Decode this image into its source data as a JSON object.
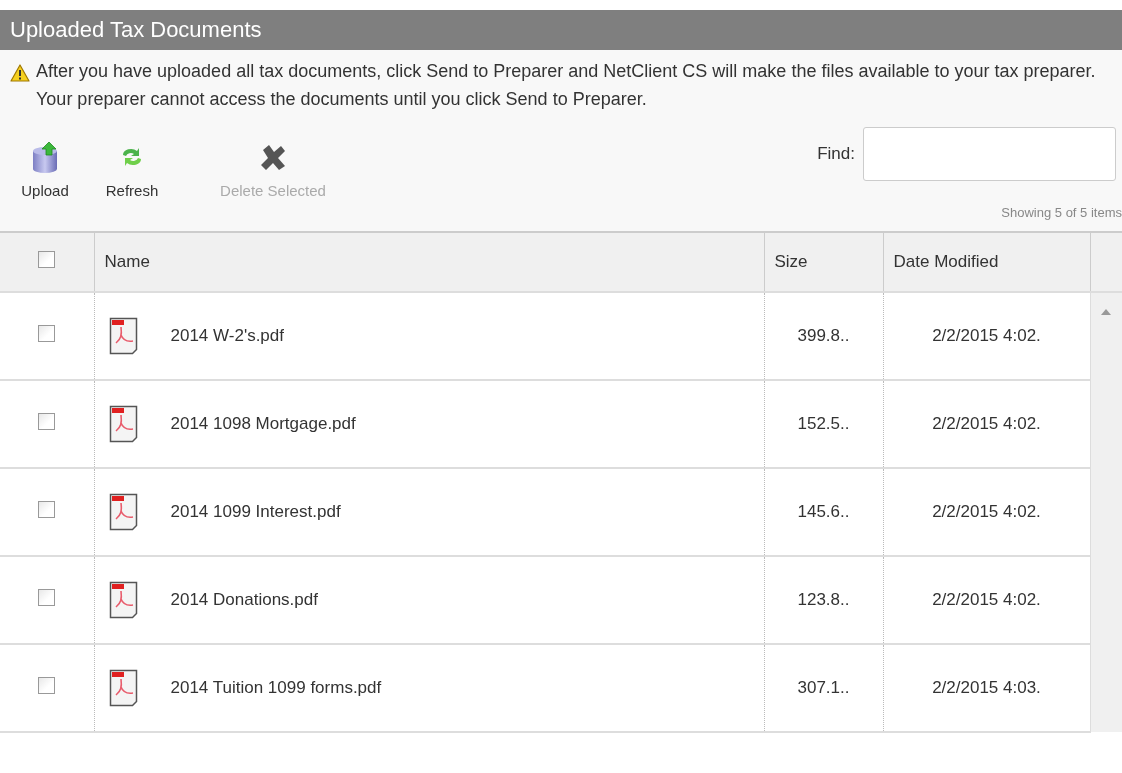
{
  "panel": {
    "title": "Uploaded Tax Documents"
  },
  "notice": {
    "text": "After you have uploaded all tax documents, click Send to Preparer and NetClient CS will make the files available to your tax preparer. Your preparer cannot access the documents until you click Send to Preparer."
  },
  "toolbar": [
    {
      "kind": "upload",
      "label": "Upload",
      "disabled": false
    },
    {
      "kind": "refresh",
      "label": "Refresh",
      "disabled": false
    },
    {
      "kind": "delete",
      "label": "Delete Selected",
      "disabled": true
    }
  ],
  "find": {
    "label": "Find:"
  },
  "status": "Showing 5 of 5 items",
  "table": {
    "select_all_checked": false,
    "columns": [
      "Name",
      "Size",
      "Date Modified"
    ],
    "rows": [
      {
        "name": "2014 W-2's.pdf",
        "size": "399.8..",
        "date": "2/2/2015 4:02.",
        "checked": false
      },
      {
        "name": "2014 1098 Mortgage.pdf",
        "size": "152.5..",
        "date": "2/2/2015 4:02.",
        "checked": false
      },
      {
        "name": "2014 1099 Interest.pdf",
        "size": "145.6..",
        "date": "2/2/2015 4:02.",
        "checked": false
      },
      {
        "name": "2014 Donations.pdf",
        "size": "123.8..",
        "date": "2/2/2015 4:02.",
        "checked": false
      },
      {
        "name": "2014 Tuition 1099 forms.pdf",
        "size": "307.1..",
        "date": "2/2/2015 4:03.",
        "checked": false
      }
    ]
  }
}
